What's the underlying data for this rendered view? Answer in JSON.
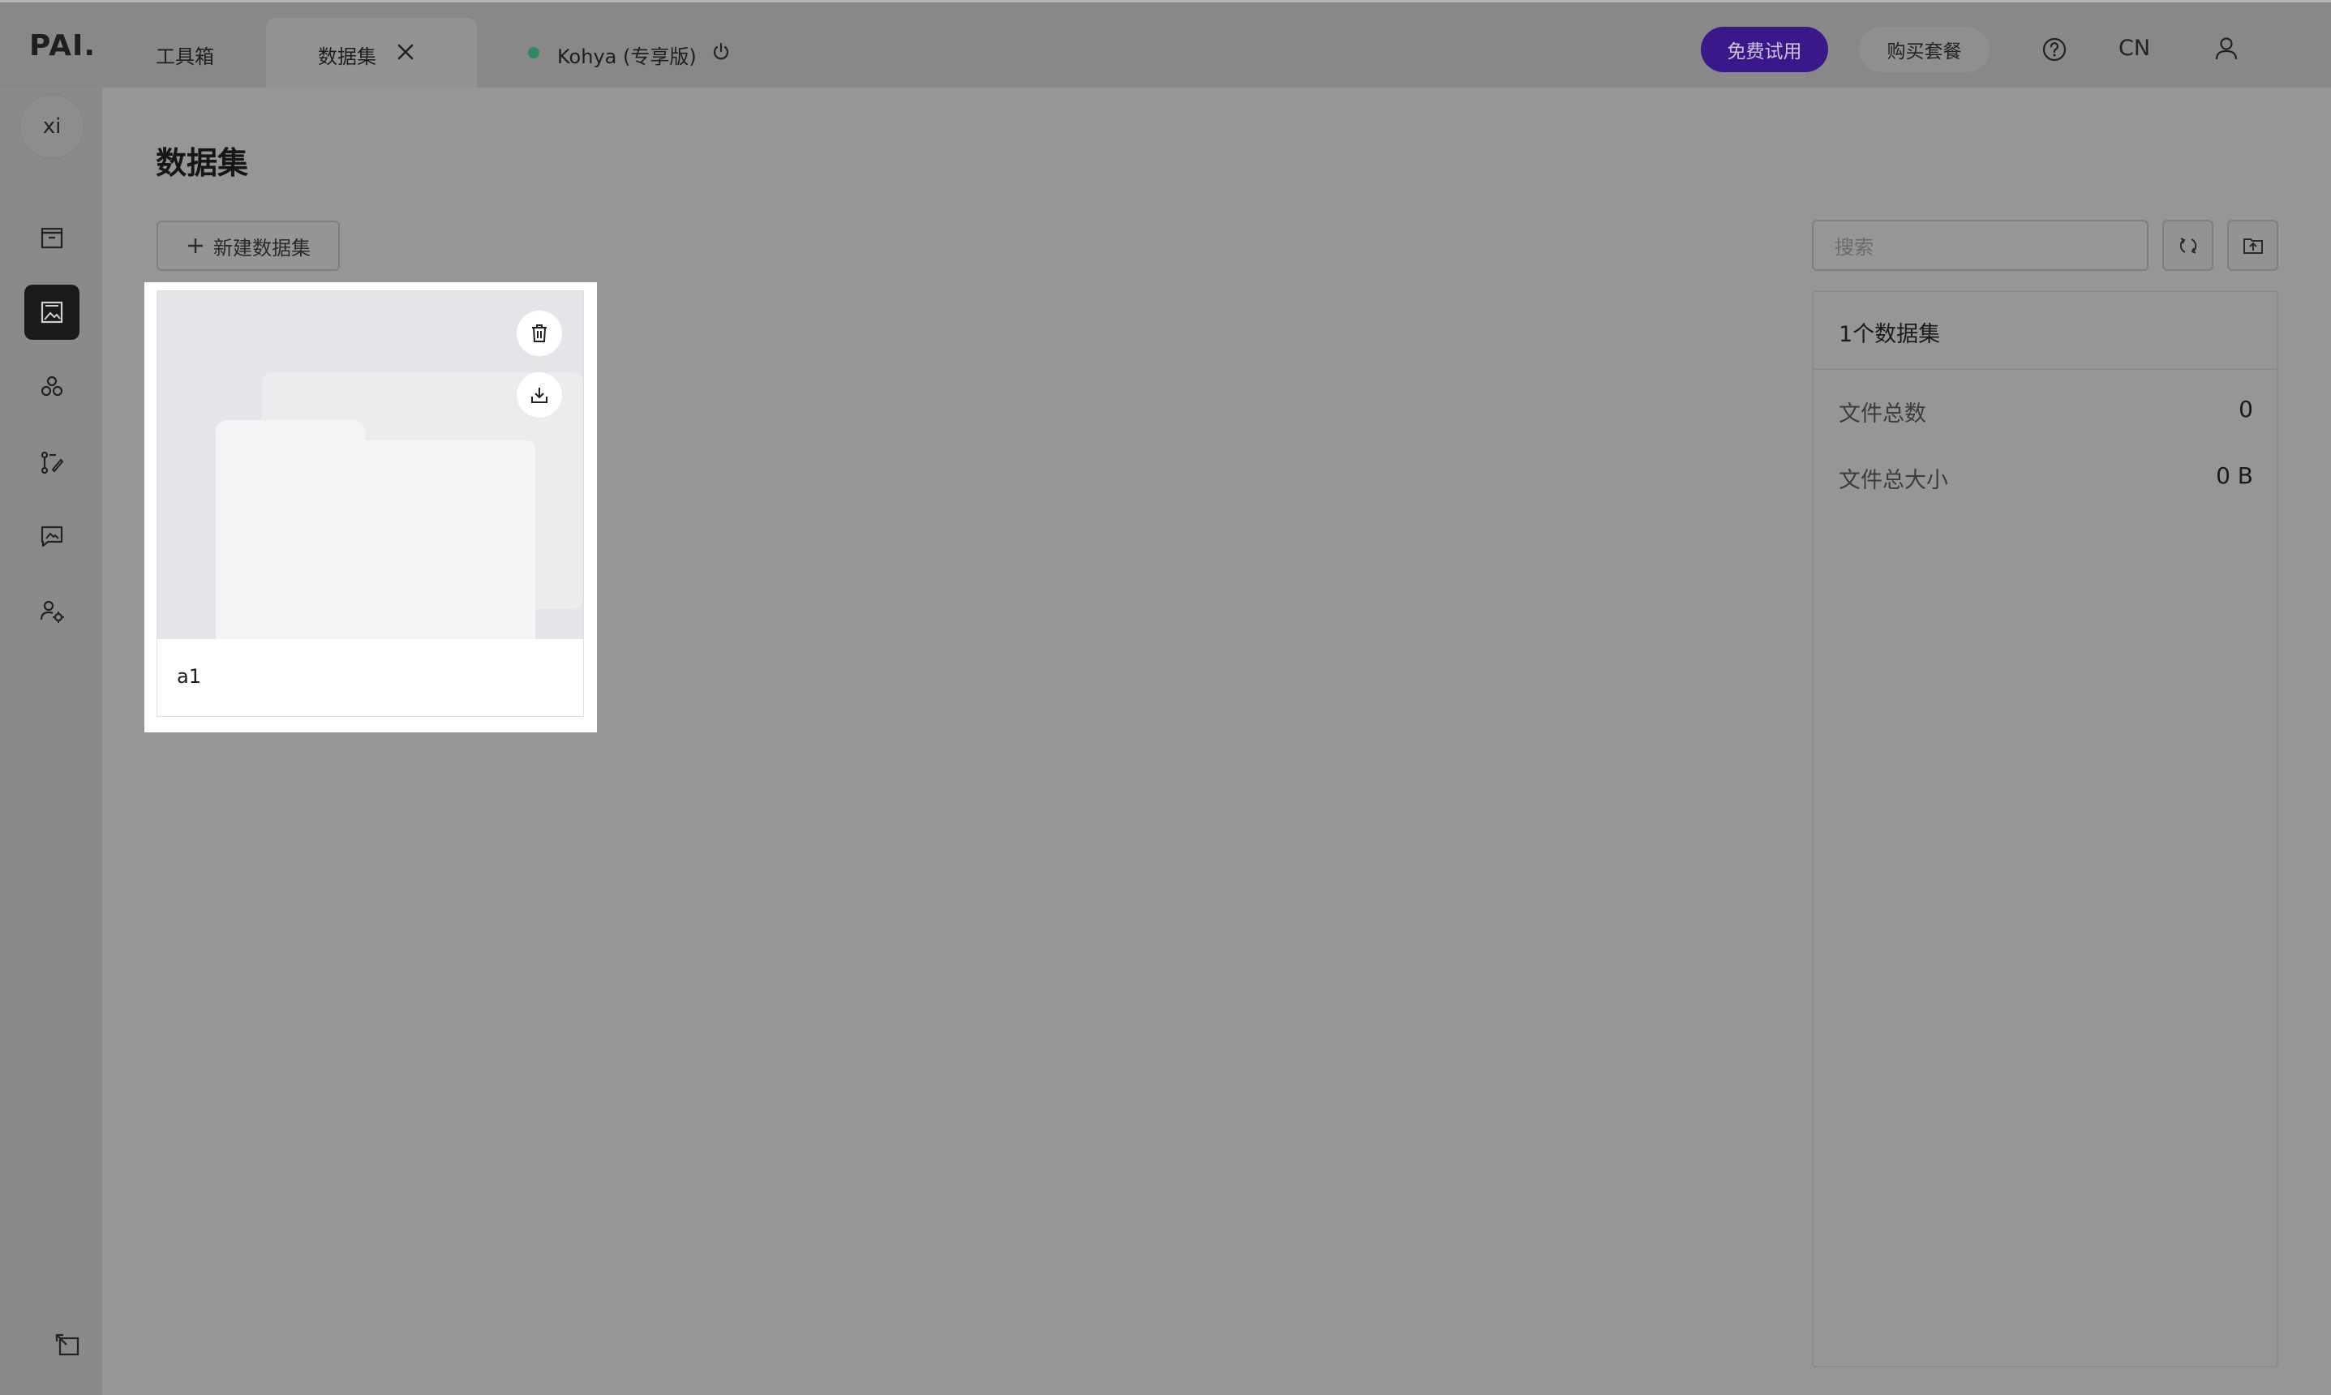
{
  "header": {
    "logo": "PAI.",
    "tabs": [
      {
        "label": "工具箱"
      },
      {
        "label": "数据集"
      }
    ],
    "service": {
      "name": "Kohya (专享版)",
      "status_color": "#2f8a61"
    },
    "trial_button": "免费试用",
    "buy_button": "购买套餐",
    "language": "CN"
  },
  "sidebar": {
    "avatar_text": "xi",
    "items": [
      {
        "icon": "toolbox-icon"
      },
      {
        "icon": "image-gallery-icon",
        "active": true
      },
      {
        "icon": "model-nodes-icon"
      },
      {
        "icon": "workflow-edit-icon"
      },
      {
        "icon": "chat-image-icon"
      },
      {
        "icon": "user-settings-icon"
      }
    ],
    "bottom_icon": "collapse-sidebar-icon"
  },
  "main": {
    "title": "数据集",
    "new_button": "新建数据集",
    "search_placeholder": "搜索",
    "datasets": [
      {
        "name": "a1"
      }
    ]
  },
  "panel": {
    "title": "1个数据集",
    "stats": [
      {
        "label": "文件总数",
        "value": "0"
      },
      {
        "label": "文件总大小",
        "value": "0 B"
      }
    ]
  },
  "colors": {
    "accent": "#3a188a",
    "overlay_gray": "#969696",
    "card_bg": "#ffffff"
  }
}
